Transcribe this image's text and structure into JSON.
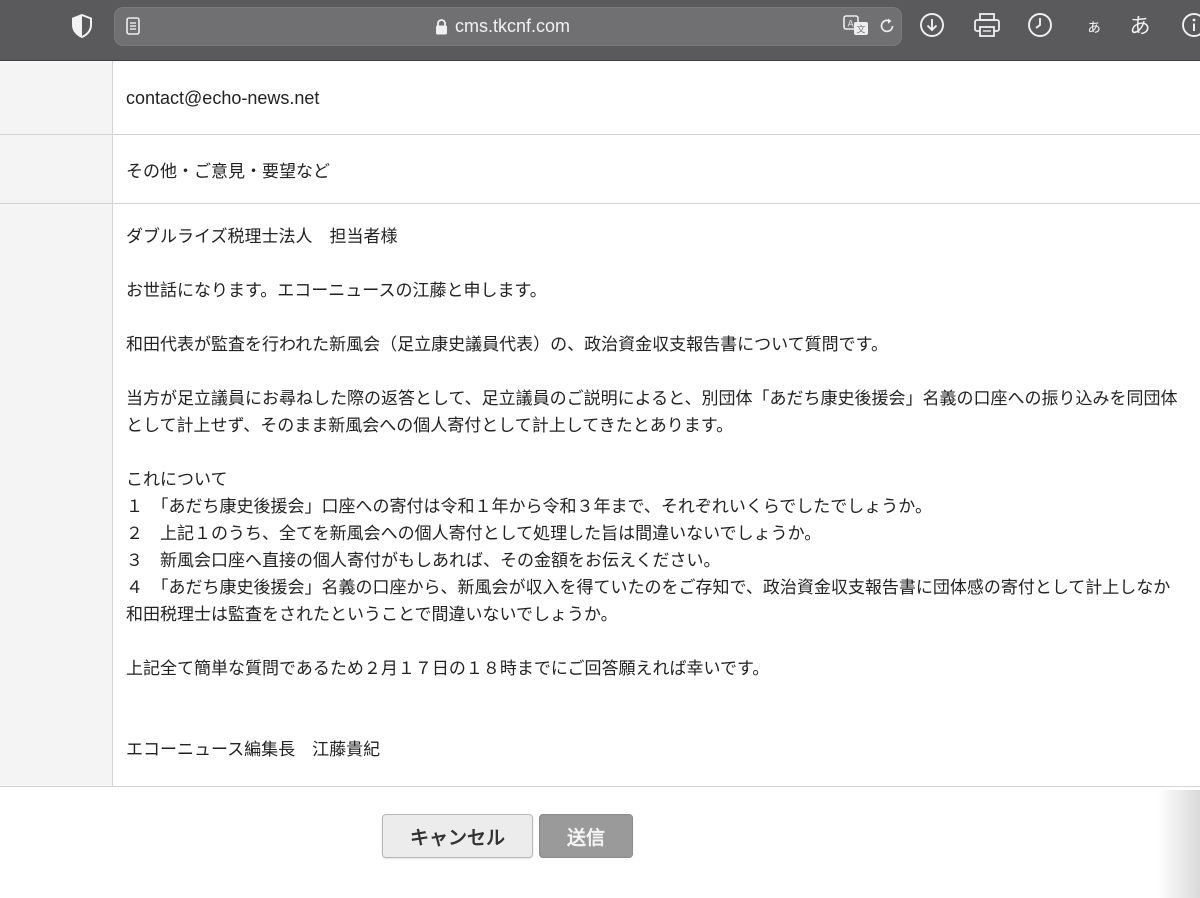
{
  "browser": {
    "url": "cms.tkcnf.com",
    "font_small_label": "ぁ",
    "font_large_label": "あ",
    "icons": [
      "shield-icon",
      "reader-icon",
      "lock-icon",
      "translate-icon",
      "reload-icon",
      "download-icon",
      "print-icon",
      "history-icon",
      "info-icon"
    ]
  },
  "form": {
    "email": "contact@echo-news.net",
    "category": "その他・ご意見・要望など",
    "message_lines": [
      "ダブルライズ税理士法人　担当者様",
      "お世話になります。エコーニュースの江藤と申します。",
      "和田代表が監査を行われた新風会（足立康史議員代表）の、政治資金収支報告書について質問です。",
      "当方が足立議員にお尋ねした際の返答として、足立議員のご説明によると、別団体「あだち康史後援会」名義の口座への振り込みを同団体",
      "として計上せず、そのまま新風会への個人寄付として計上してきたとあります。",
      "これについて",
      "１　「あだち康史後援会」口座への寄付は令和１年から令和３年まで、それぞれいくらでしたでしょうか。",
      "２　上記１のうち、全てを新風会への個人寄付として処理した旨は間違いないでしょうか。",
      "３　新風会口座へ直接の個人寄付がもしあれば、その金額をお伝えください。",
      "４　「あだち康史後援会」名義の口座から、新風会が収入を得ていたのをご存知で、政治資金収支報告書に団体感の寄付として計上しなか",
      "和田税理士は監査をされたということで間違いないでしょうか。",
      "上記全て簡単な質問であるため２月１７日の１８時までにご回答願えれば幸いです。",
      "エコーニュース編集長　江藤貴紀"
    ]
  },
  "buttons": {
    "cancel_label": "キャンセル",
    "submit_label": "送信"
  },
  "colors": {
    "toolbar": "#5a5a5c",
    "label_cell": "#f4f4f4",
    "submit_button": "#9a9a9a",
    "cancel_button": "#ececec"
  }
}
